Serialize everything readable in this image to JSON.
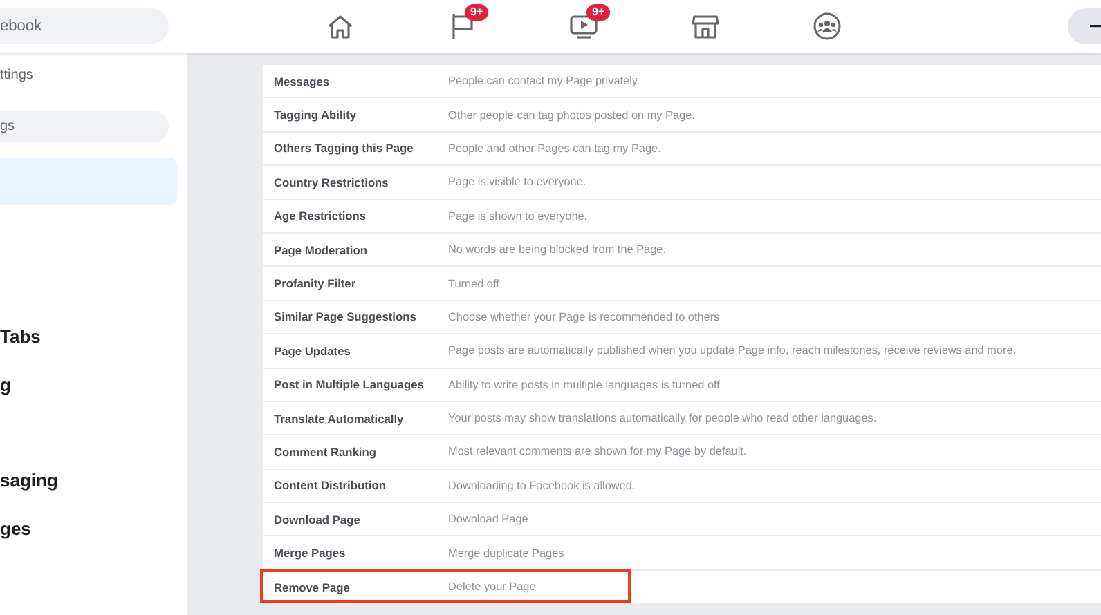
{
  "topbar": {
    "search": {
      "value": "ebook"
    },
    "nav": [
      {
        "kind": "home"
      },
      {
        "kind": "flag",
        "badge": "9+"
      },
      {
        "kind": "video",
        "badge": "9+"
      },
      {
        "kind": "store"
      },
      {
        "kind": "groups"
      }
    ]
  },
  "sidebar": {
    "items": [
      {
        "kind": "text",
        "label": "ttings",
        "selected": false
      },
      {
        "kind": "pill",
        "label": "gs",
        "selected": false
      },
      {
        "kind": "pill",
        "selected": true
      },
      {
        "kind": "heading",
        "label": "Tabs",
        "selected": false
      },
      {
        "kind": "heading",
        "label": "g",
        "selected": false
      },
      {
        "kind": "heading",
        "label": "saging",
        "selected": false
      },
      {
        "kind": "heading",
        "label": "ges",
        "selected": false
      }
    ]
  },
  "settings": {
    "rows": [
      {
        "label": "Messages",
        "value": "People can contact my Page privately.",
        "highlighted": false
      },
      {
        "label": "Tagging Ability",
        "value": "Other people can tag photos posted on my Page.",
        "highlighted": false
      },
      {
        "label": "Others Tagging this Page",
        "value": "People and other Pages can tag my Page.",
        "highlighted": false
      },
      {
        "label": "Country Restrictions",
        "value": "Page is visible to everyone.",
        "highlighted": false
      },
      {
        "label": "Age Restrictions",
        "value": "Page is shown to everyone.",
        "highlighted": false
      },
      {
        "label": "Page Moderation",
        "value": "No words are being blocked from the Page.",
        "highlighted": false
      },
      {
        "label": "Profanity Filter",
        "value": "Turned off",
        "highlighted": false
      },
      {
        "label": "Similar Page Suggestions",
        "value": "Choose whether your Page is recommended to others",
        "highlighted": false
      },
      {
        "label": "Page Updates",
        "value": "Page posts are automatically published when you update Page info, reach milestones, receive reviews and more.",
        "highlighted": false
      },
      {
        "label": "Post in Multiple Languages",
        "value": "Ability to write posts in multiple languages is turned off",
        "highlighted": false
      },
      {
        "label": "Translate Automatically",
        "value": "Your posts may show translations automatically for people who read other languages.",
        "highlighted": false
      },
      {
        "label": "Comment Ranking",
        "value": "Most relevant comments are shown for my Page by default.",
        "highlighted": false
      },
      {
        "label": "Content Distribution",
        "value": "Downloading to Facebook is allowed.",
        "highlighted": false
      },
      {
        "label": "Download Page",
        "value": "Download Page",
        "highlighted": false
      },
      {
        "label": "Merge Pages",
        "value": "Merge duplicate Pages",
        "highlighted": false
      },
      {
        "label": "Remove Page",
        "value": "Delete your Page",
        "highlighted": true
      }
    ]
  }
}
